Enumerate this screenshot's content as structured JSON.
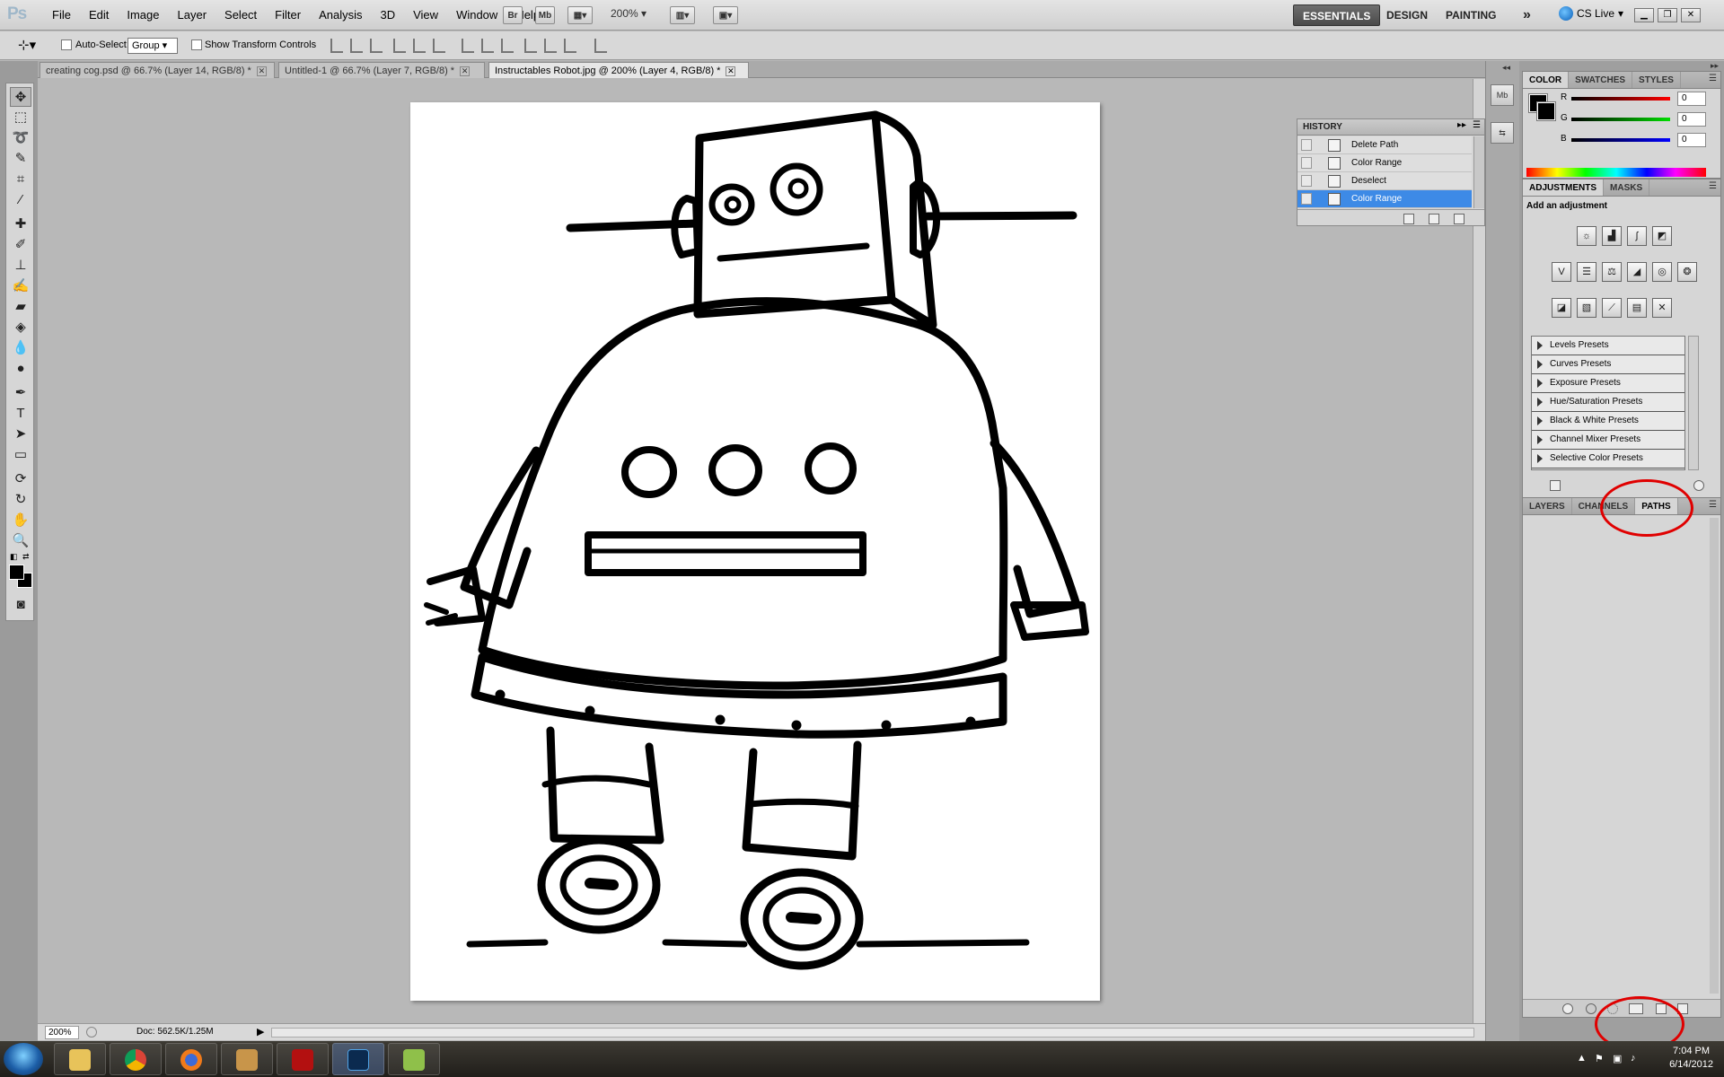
{
  "app": {
    "logo": "Ps"
  },
  "menu": [
    "File",
    "Edit",
    "Image",
    "Layer",
    "Select",
    "Filter",
    "Analysis",
    "3D",
    "View",
    "Window",
    "Help"
  ],
  "launch": {
    "bridge": "Br",
    "minibridge": "Mb",
    "zoom": "200%"
  },
  "workspaces": {
    "essentials": "ESSENTIALS",
    "design": "DESIGN",
    "painting": "PAINTING",
    "more": "»"
  },
  "cslive": "CS Live",
  "options": {
    "auto_select_label": "Auto-Select:",
    "auto_select_value": "Group",
    "transform_label": "Show Transform Controls"
  },
  "tabs": [
    {
      "title": "creating cog.psd @ 66.7% (Layer 14, RGB/8) *"
    },
    {
      "title": "Untitled-1 @ 66.7% (Layer 7, RGB/8) *"
    },
    {
      "title": "Instructables Robot.jpg @ 200% (Layer 4, RGB/8) *"
    }
  ],
  "status": {
    "zoom": "200%",
    "doc": "Doc: 562.5K/1.25M"
  },
  "history": {
    "title": "HISTORY",
    "items": [
      {
        "label": "Delete Path"
      },
      {
        "label": "Color Range"
      },
      {
        "label": "Deselect"
      },
      {
        "label": "Color Range"
      }
    ]
  },
  "color_panel": {
    "tabs": [
      "COLOR",
      "SWATCHES",
      "STYLES"
    ],
    "channels": [
      {
        "name": "R",
        "value": "0",
        "color": "#e01010"
      },
      {
        "name": "G",
        "value": "0",
        "color": "#10c010"
      },
      {
        "name": "B",
        "value": "0",
        "color": "#1010e0"
      }
    ]
  },
  "adjustments": {
    "tabs": [
      "ADJUSTMENTS",
      "MASKS"
    ],
    "title": "Add an adjustment",
    "presets": [
      "Levels Presets",
      "Curves Presets",
      "Exposure Presets",
      "Hue/Saturation Presets",
      "Black & White Presets",
      "Channel Mixer Presets",
      "Selective Color Presets"
    ]
  },
  "layers_panel": {
    "tabs": [
      "LAYERS",
      "CHANNELS",
      "PATHS"
    ],
    "active_tab": "PATHS"
  },
  "clock": {
    "time": "7:04 PM",
    "date": "6/14/2012"
  },
  "colors": {
    "selection": "#3d8ae6",
    "annotation": "#e00000",
    "workspace_active": "#4a4a4a"
  }
}
